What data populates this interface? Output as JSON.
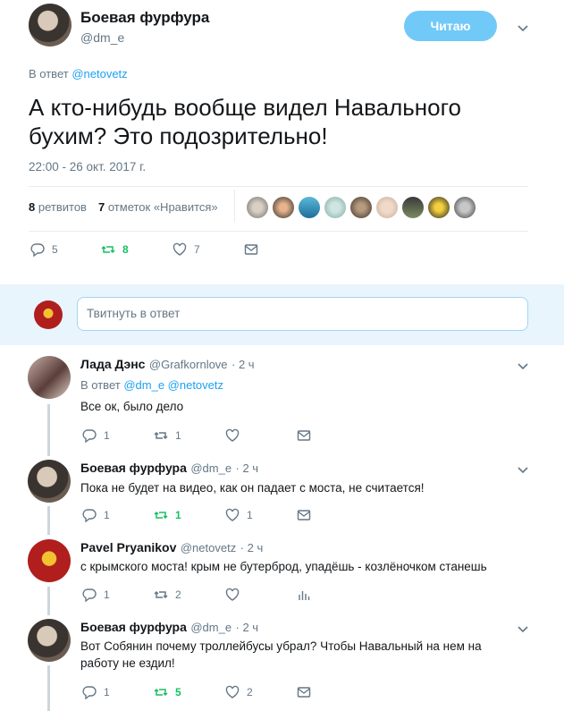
{
  "tweet": {
    "author_name": "Боевая фурфура",
    "author_handle": "@dm_e",
    "follow_label": "Читаю",
    "reply_to_prefix": "В ответ",
    "reply_to_handle": "@netovetz",
    "text_line1": "А кто-нибудь вообще видел Навального",
    "text_line2": "бухим? Это подозрительно!",
    "timestamp": "22:00 - 26 окт. 2017 г.",
    "retweets_count": "8",
    "retweets_label": "ретвитов",
    "likes_count": "7",
    "likes_label": "отметок «Нравится»",
    "actions": {
      "replies": "5",
      "retweets": "8",
      "likes": "7"
    }
  },
  "reply_box": {
    "placeholder": "Твитнуть в ответ"
  },
  "replies": [
    {
      "name": "Лада Дэнс",
      "handle": "@Grafkornlove",
      "time": "· 2 ч",
      "reply_prefix": "В ответ",
      "reply_handles": "@dm_e @netovetz",
      "text": "Все ок, было дело",
      "replies": "1",
      "retweets": "1",
      "likes": ""
    },
    {
      "name": "Боевая фурфура",
      "handle": "@dm_e",
      "time": "· 2 ч",
      "text": "Пока не будет на видео, как он падает с моста, не считается!",
      "replies": "1",
      "retweets": "1",
      "likes": "1"
    },
    {
      "name": "Pavel Pryanikov",
      "handle": "@netovetz",
      "time": "· 2 ч",
      "text": "с крымского моста! крым не бутерброд, упадёшь - козлёночком станешь",
      "replies": "1",
      "retweets": "2",
      "likes": ""
    },
    {
      "name": "Боевая фурфура",
      "handle": "@dm_e",
      "time": "· 2 ч",
      "text_line1": "Вот Собянин почему троллейбусы убрал? Чтобы Навальный на нем на",
      "text_line2": "работу не ездил!",
      "replies": "1",
      "retweets": "5",
      "likes": "2"
    }
  ],
  "colors": {
    "accent": "#1da1f2",
    "retweet_active": "#17bf63",
    "muted": "#657786"
  }
}
